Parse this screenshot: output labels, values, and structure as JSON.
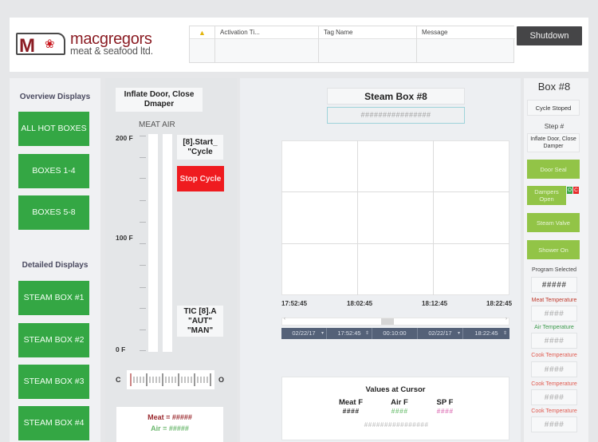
{
  "brand": {
    "logo_letter": "M",
    "name": "macgregors",
    "subtitle": "meat & seafood ltd.",
    "primary_color": "#8b1d24"
  },
  "alarms": {
    "columns": [
      "Activation Ti...",
      "Tag Name",
      "Message"
    ],
    "icon": "warning-icon",
    "rows": []
  },
  "header": {
    "shutdown_label": "Shutdown"
  },
  "left_nav": {
    "overview_title": "Overview Displays",
    "overview_items": [
      "ALL HOT BOXES",
      "BOXES 1-4",
      "BOXES 5-8"
    ],
    "detailed_title": "Detailed Displays",
    "detailed_items": [
      "STEAM BOX #1",
      "STEAM BOX #2",
      "STEAM BOX #3",
      "STEAM BOX #4"
    ],
    "button_color": "#34a744"
  },
  "gauge": {
    "step_text": "Inflate Door, Close Dmaper",
    "bar_labels": "MEAT AIR",
    "axis": [
      "200 F",
      "100 F",
      "0 F"
    ],
    "start_cycle": "[8].Start_ \"Cycle",
    "stop_cycle": "Stop Cycle",
    "tic_mode": "TIC [8].A \"AUT\" \"MAN\"",
    "valve_left": "C",
    "valve_right": "O",
    "meat_readout": "Meat = #####",
    "air_readout": "Air = #####"
  },
  "center": {
    "title": "Steam Box #8",
    "subtitle": "################",
    "chart": {
      "x_labels": [
        "17:52:45",
        "18:02:45",
        "18:12:45",
        "18:22:45"
      ]
    },
    "range": {
      "start_date": "02/22/17",
      "start_time": "17:52:45",
      "duration": "00:10:00",
      "end_date": "02/22/17",
      "end_time": "18:22:45"
    },
    "cursor": {
      "title": "Values at Cursor",
      "meat_label": "Meat F",
      "meat_value": "####",
      "air_label": "Air F",
      "air_value": "####",
      "sp_label": "SP F",
      "sp_value": "####",
      "footer": "################"
    }
  },
  "right_panel": {
    "title": "Box #8",
    "cycle_status": "Cycle Stoped",
    "step_label": "Step #",
    "step_value": "Inflate Door, Close Damper",
    "door_seal": "Door Seal",
    "dampers_open": "Dampers Open",
    "damper_o": "O",
    "damper_c": "C",
    "steam_valve": "Steam Valve",
    "shower_on": "Shower On",
    "program_label": "Program Selected",
    "program_value": "#####",
    "temps": [
      {
        "label": "Meat Temperature",
        "value": "####",
        "color": "#c0392b"
      },
      {
        "label": "Air Temperature",
        "value": "####",
        "color": "#3a9a4a"
      },
      {
        "label": "Cook Temperature",
        "value": "####",
        "color": "#e05a4f"
      },
      {
        "label": "Cook Temperature",
        "value": "####",
        "color": "#e05a4f"
      },
      {
        "label": "Cook Temperature",
        "value": "####",
        "color": "#e05a4f"
      }
    ]
  }
}
